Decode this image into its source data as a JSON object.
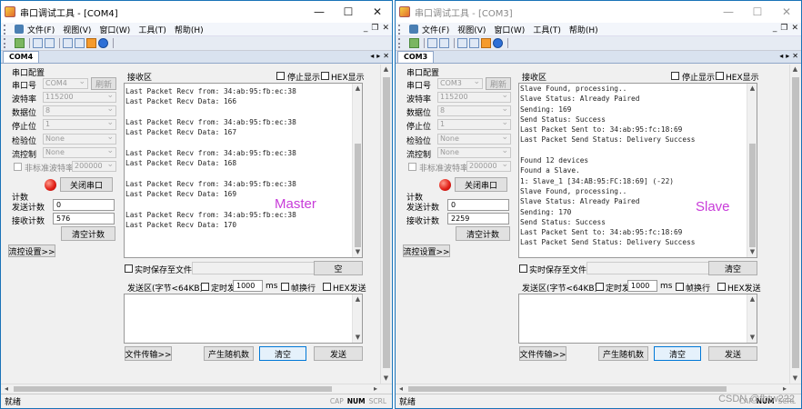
{
  "left": {
    "title": "串口调试工具 - [COM4]",
    "menu": [
      "文件(F)",
      "视图(V)",
      "窗口(W)",
      "工具(T)",
      "帮助(H)"
    ],
    "tab": "COM4",
    "port_group_title": "串口配置",
    "labels": {
      "port": "串口号",
      "baud": "波特率",
      "databits": "数据位",
      "stopbits": "停止位",
      "parity": "检验位",
      "flow": "流控制",
      "nonstd": "非标准波特率"
    },
    "values": {
      "port": "COM4",
      "baud": "115200",
      "databits": "8",
      "stopbits": "1",
      "parity": "None",
      "flow": "None",
      "nonstd": "200000"
    },
    "refresh_button": "刷新",
    "close_port_button": "关闭串口",
    "count_title": "计数",
    "send_count_label": "发送计数",
    "send_count_value": "0",
    "recv_count_label": "接收计数",
    "recv_count_value": "576",
    "clear_count_button": "清空计数",
    "flow_settings_button": "流控设置>>",
    "recv_area_label": "接收区",
    "stop_display_label": "停止显示",
    "hex_display_label": "HEX显示",
    "recv_lines": [
      "Last Packet Recv from: 34:ab:95:fb:ec:38",
      "Last Packet Recv Data: 166",
      "",
      "Last Packet Recv from: 34:ab:95:fb:ec:38",
      "Last Packet Recv Data: 167",
      "",
      "Last Packet Recv from: 34:ab:95:fb:ec:38",
      "Last Packet Recv Data: 168",
      "",
      "Last Packet Recv from: 34:ab:95:fb:ec:38",
      "Last Packet Recv Data: 169",
      "",
      "Last Packet Recv from: 34:ab:95:fb:ec:38",
      "Last Packet Recv Data: 170"
    ],
    "overlay": "Master",
    "realtime_save_label": "实时保存至文件",
    "save_clear_button": "空",
    "send_area_label": "发送区(字节<64KB)",
    "timed_send_label": "定时发送",
    "timed_send_value": "1000",
    "ms_label": "ms",
    "newline_label": "帧换行",
    "hex_send_label": "HEX发送",
    "file_transfer_button": "文件传输>>",
    "random_button": "产生随机数",
    "clear_button": "清空",
    "send_button": "发送",
    "status": "就绪",
    "indicators": {
      "cap": "CAP",
      "num": "NUM",
      "scrl": "SCRL"
    }
  },
  "right": {
    "title": "串口调试工具 - [COM3]",
    "menu": [
      "文件(F)",
      "视图(V)",
      "窗口(W)",
      "工具(T)",
      "帮助(H)"
    ],
    "tab": "COM3",
    "port_group_title": "串口配置",
    "labels": {
      "port": "串口号",
      "baud": "波特率",
      "databits": "数据位",
      "stopbits": "停止位",
      "parity": "检验位",
      "flow": "流控制",
      "nonstd": "非标准波特率"
    },
    "values": {
      "port": "COM3",
      "baud": "115200",
      "databits": "8",
      "stopbits": "1",
      "parity": "None",
      "flow": "None",
      "nonstd": "200000"
    },
    "refresh_button": "刷新",
    "close_port_button": "关闭串口",
    "count_title": "计数",
    "send_count_label": "发送计数",
    "send_count_value": "0",
    "recv_count_label": "接收计数",
    "recv_count_value": "2259",
    "clear_count_button": "清空计数",
    "flow_settings_button": "流控设置>>",
    "recv_area_label": "接收区",
    "stop_display_label": "停止显示",
    "hex_display_label": "HEX显示",
    "recv_lines": [
      "Slave Found, processing..",
      "Slave Status: Already Paired",
      "Sending: 169",
      "Send Status: Success",
      "Last Packet Sent to: 34:ab:95:fc:18:69",
      "Last Packet Send Status: Delivery Success",
      "",
      "Found 12 devices",
      "Found a Slave.",
      "1: Slave_1 [34:AB:95:FC:18:69] (-22)",
      "Slave Found, processing..",
      "Slave Status: Already Paired",
      "Sending: 170",
      "Send Status: Success",
      "Last Packet Sent to: 34:ab:95:fc:18:69",
      "Last Packet Send Status: Delivery Success"
    ],
    "overlay": "Slave",
    "realtime_save_label": "实时保存至文件",
    "save_clear_button": "清空",
    "send_area_label": "发送区(字节<64KB)",
    "timed_send_label": "定时发送",
    "timed_send_value": "1000",
    "ms_label": "ms",
    "newline_label": "帧换行",
    "hex_send_label": "HEX发送",
    "file_transfer_button": "文件传输>>",
    "random_button": "产生随机数",
    "clear_button": "清空",
    "send_button": "发送",
    "status": "就绪",
    "indicators": {
      "cap": "CAP",
      "num": "NUM",
      "scrl": "SCRL"
    }
  },
  "watermark": "CSDN @fbtw222"
}
